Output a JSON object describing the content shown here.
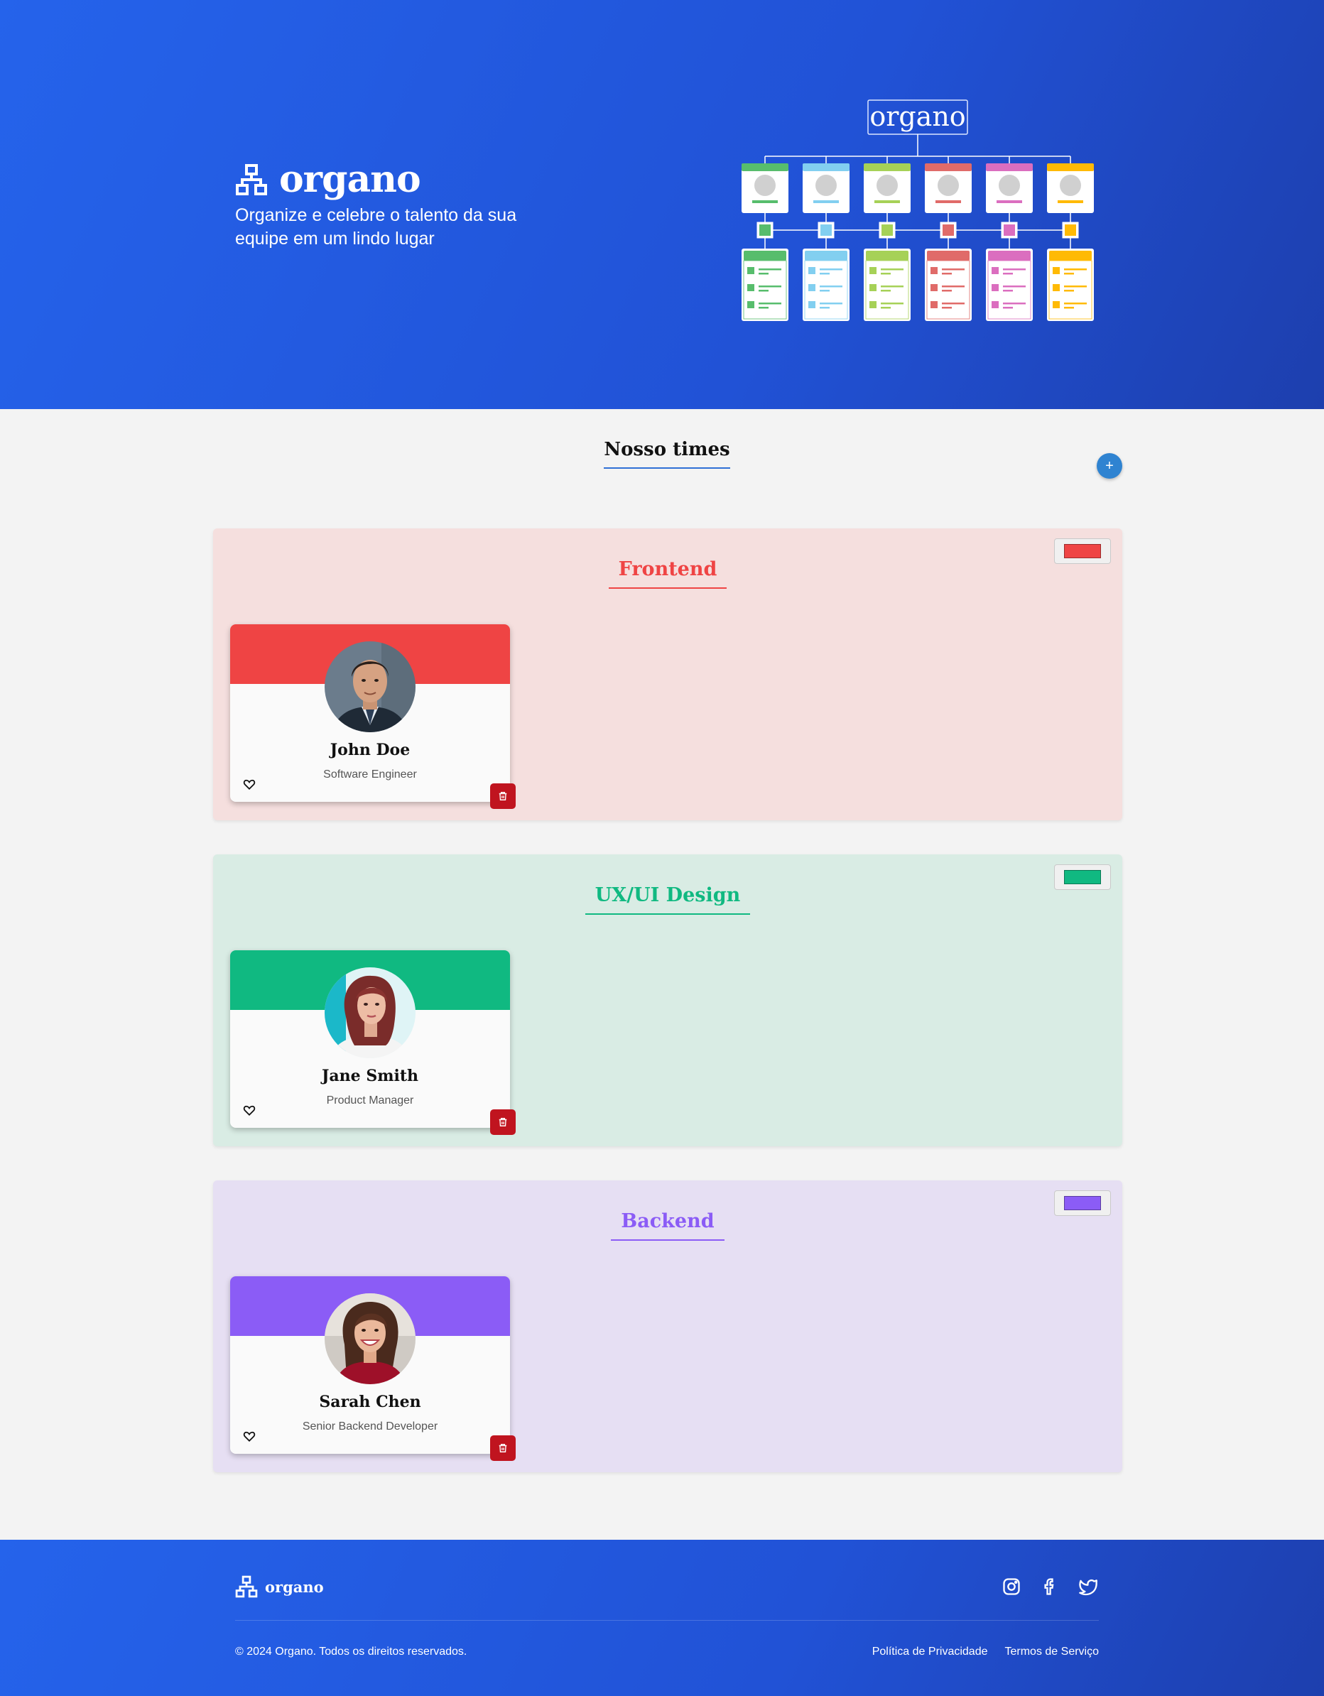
{
  "header": {
    "brand_name": "organo",
    "tagline": "Organize e celebre o talento da sua equipe em um lindo lugar",
    "illustration_title": "organo",
    "illustration_colors": [
      "#57bd6c",
      "#82cff0",
      "#a6d157",
      "#e06b69",
      "#db6ebf",
      "#ffba05"
    ]
  },
  "main": {
    "section_title": "Nosso times",
    "add_button_label": "+",
    "teams": [
      {
        "name": "Frontend",
        "color": "#ef4444",
        "background": "#f5dfde",
        "members": [
          {
            "name": "John Doe",
            "role": "Software Engineer"
          }
        ]
      },
      {
        "name": "UX/UI Design",
        "color": "#10b981",
        "background": "#d9ece4",
        "members": [
          {
            "name": "Jane Smith",
            "role": "Product Manager"
          }
        ]
      },
      {
        "name": "Backend",
        "color": "#8b5cf6",
        "background": "#e6dff3",
        "members": [
          {
            "name": "Sarah Chen",
            "role": "Senior Backend Developer"
          }
        ]
      }
    ]
  },
  "footer": {
    "brand_name": "organo",
    "social_icons": [
      "instagram-icon",
      "facebook-icon",
      "twitter-icon"
    ],
    "copyright": "© 2024 Organo. Todos os direitos reservados.",
    "links": [
      "Política de Privacidade",
      "Termos de Serviço"
    ]
  }
}
